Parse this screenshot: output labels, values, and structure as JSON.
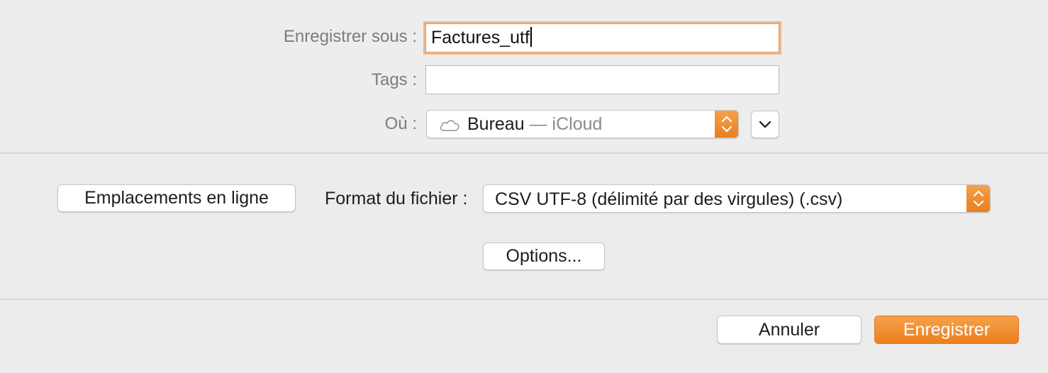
{
  "save_as": {
    "label": "Enregistrer sous :",
    "value": "Factures_utf"
  },
  "tags": {
    "label": "Tags :",
    "value": ""
  },
  "where": {
    "label": "Où :",
    "location": "Bureau",
    "separator": " — ",
    "service": "iCloud",
    "icon": "cloud-icon"
  },
  "online_locations_button": "Emplacements en ligne",
  "file_format": {
    "label": "Format du fichier :",
    "selected": "CSV UTF-8 (délimité par des virgules) (.csv)"
  },
  "options_button": "Options...",
  "cancel_button": "Annuler",
  "save_button": "Enregistrer",
  "colors": {
    "accent": "#ee8826",
    "focus_ring": "#f0b68a",
    "background": "#ececec"
  }
}
